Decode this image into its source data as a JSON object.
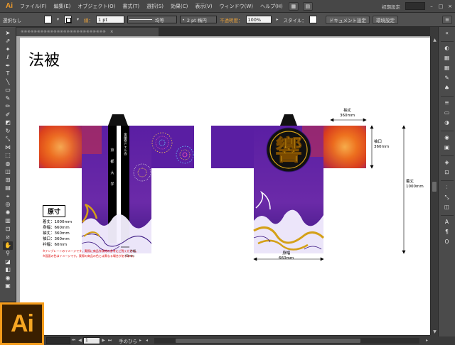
{
  "app": {
    "logo": "Ai",
    "workspace": "初期設定",
    "menus": [
      "ファイル(F)",
      "編集(E)",
      "オブジェクト(O)",
      "書式(T)",
      "選択(S)",
      "効果(C)",
      "表示(V)",
      "ウィンドウ(W)",
      "ヘルプ(H)"
    ]
  },
  "control": {
    "selection": "選択なし",
    "stroke_label": "線：",
    "stroke_value": "1 pt",
    "line_style": "均等",
    "brush": "2 pt 楕円",
    "opacity_label": "不透明度：",
    "opacity_value": "100%",
    "style_label": "スタイル：",
    "doc_settings": "ドキュメント設定",
    "prefs": "環境設定"
  },
  "tab": {
    "doc_name": "※※※※※※※※※※※※※※※※※※※※※※※※※※"
  },
  "status": {
    "zoom": "",
    "page": "1",
    "tool": "手のひら"
  },
  "artboard": {
    "title": "法被",
    "spec": {
      "heading": "原寸",
      "lines": [
        "着丈：1000mm",
        "身幅：660mm",
        "袖丈：360mm",
        "袖口：360mm",
        "衿幅：60mm"
      ],
      "notes": [
        "※テンプレートのイメージです。実際に商品作成時の参考にご覧ください。",
        "※画面の色はイメージです。実際の商品の色とは異なる場合があります。"
      ]
    },
    "eri_text": [
      "京",
      "都",
      "大",
      "学"
    ],
    "eri_text2": "金蘭祭ドエル会",
    "collar_width": "衿幅",
    "collar_mm": "60mm",
    "kanji": "響",
    "dims": {
      "sode_take_label": "袖丈",
      "sode_take_mm": "360mm",
      "sode_guchi_label": "袖口",
      "sode_guchi_mm": "360mm",
      "kitake_label": "着丈",
      "kitake_mm": "1000mm",
      "mihaba_label": "身幅",
      "mihaba_mm": "660mm"
    }
  },
  "colors": {
    "purple": "#5a1ea3",
    "orange_flame": "#e85a1a",
    "gold": "#d4a017",
    "ai_orange": "#f49b1a"
  }
}
